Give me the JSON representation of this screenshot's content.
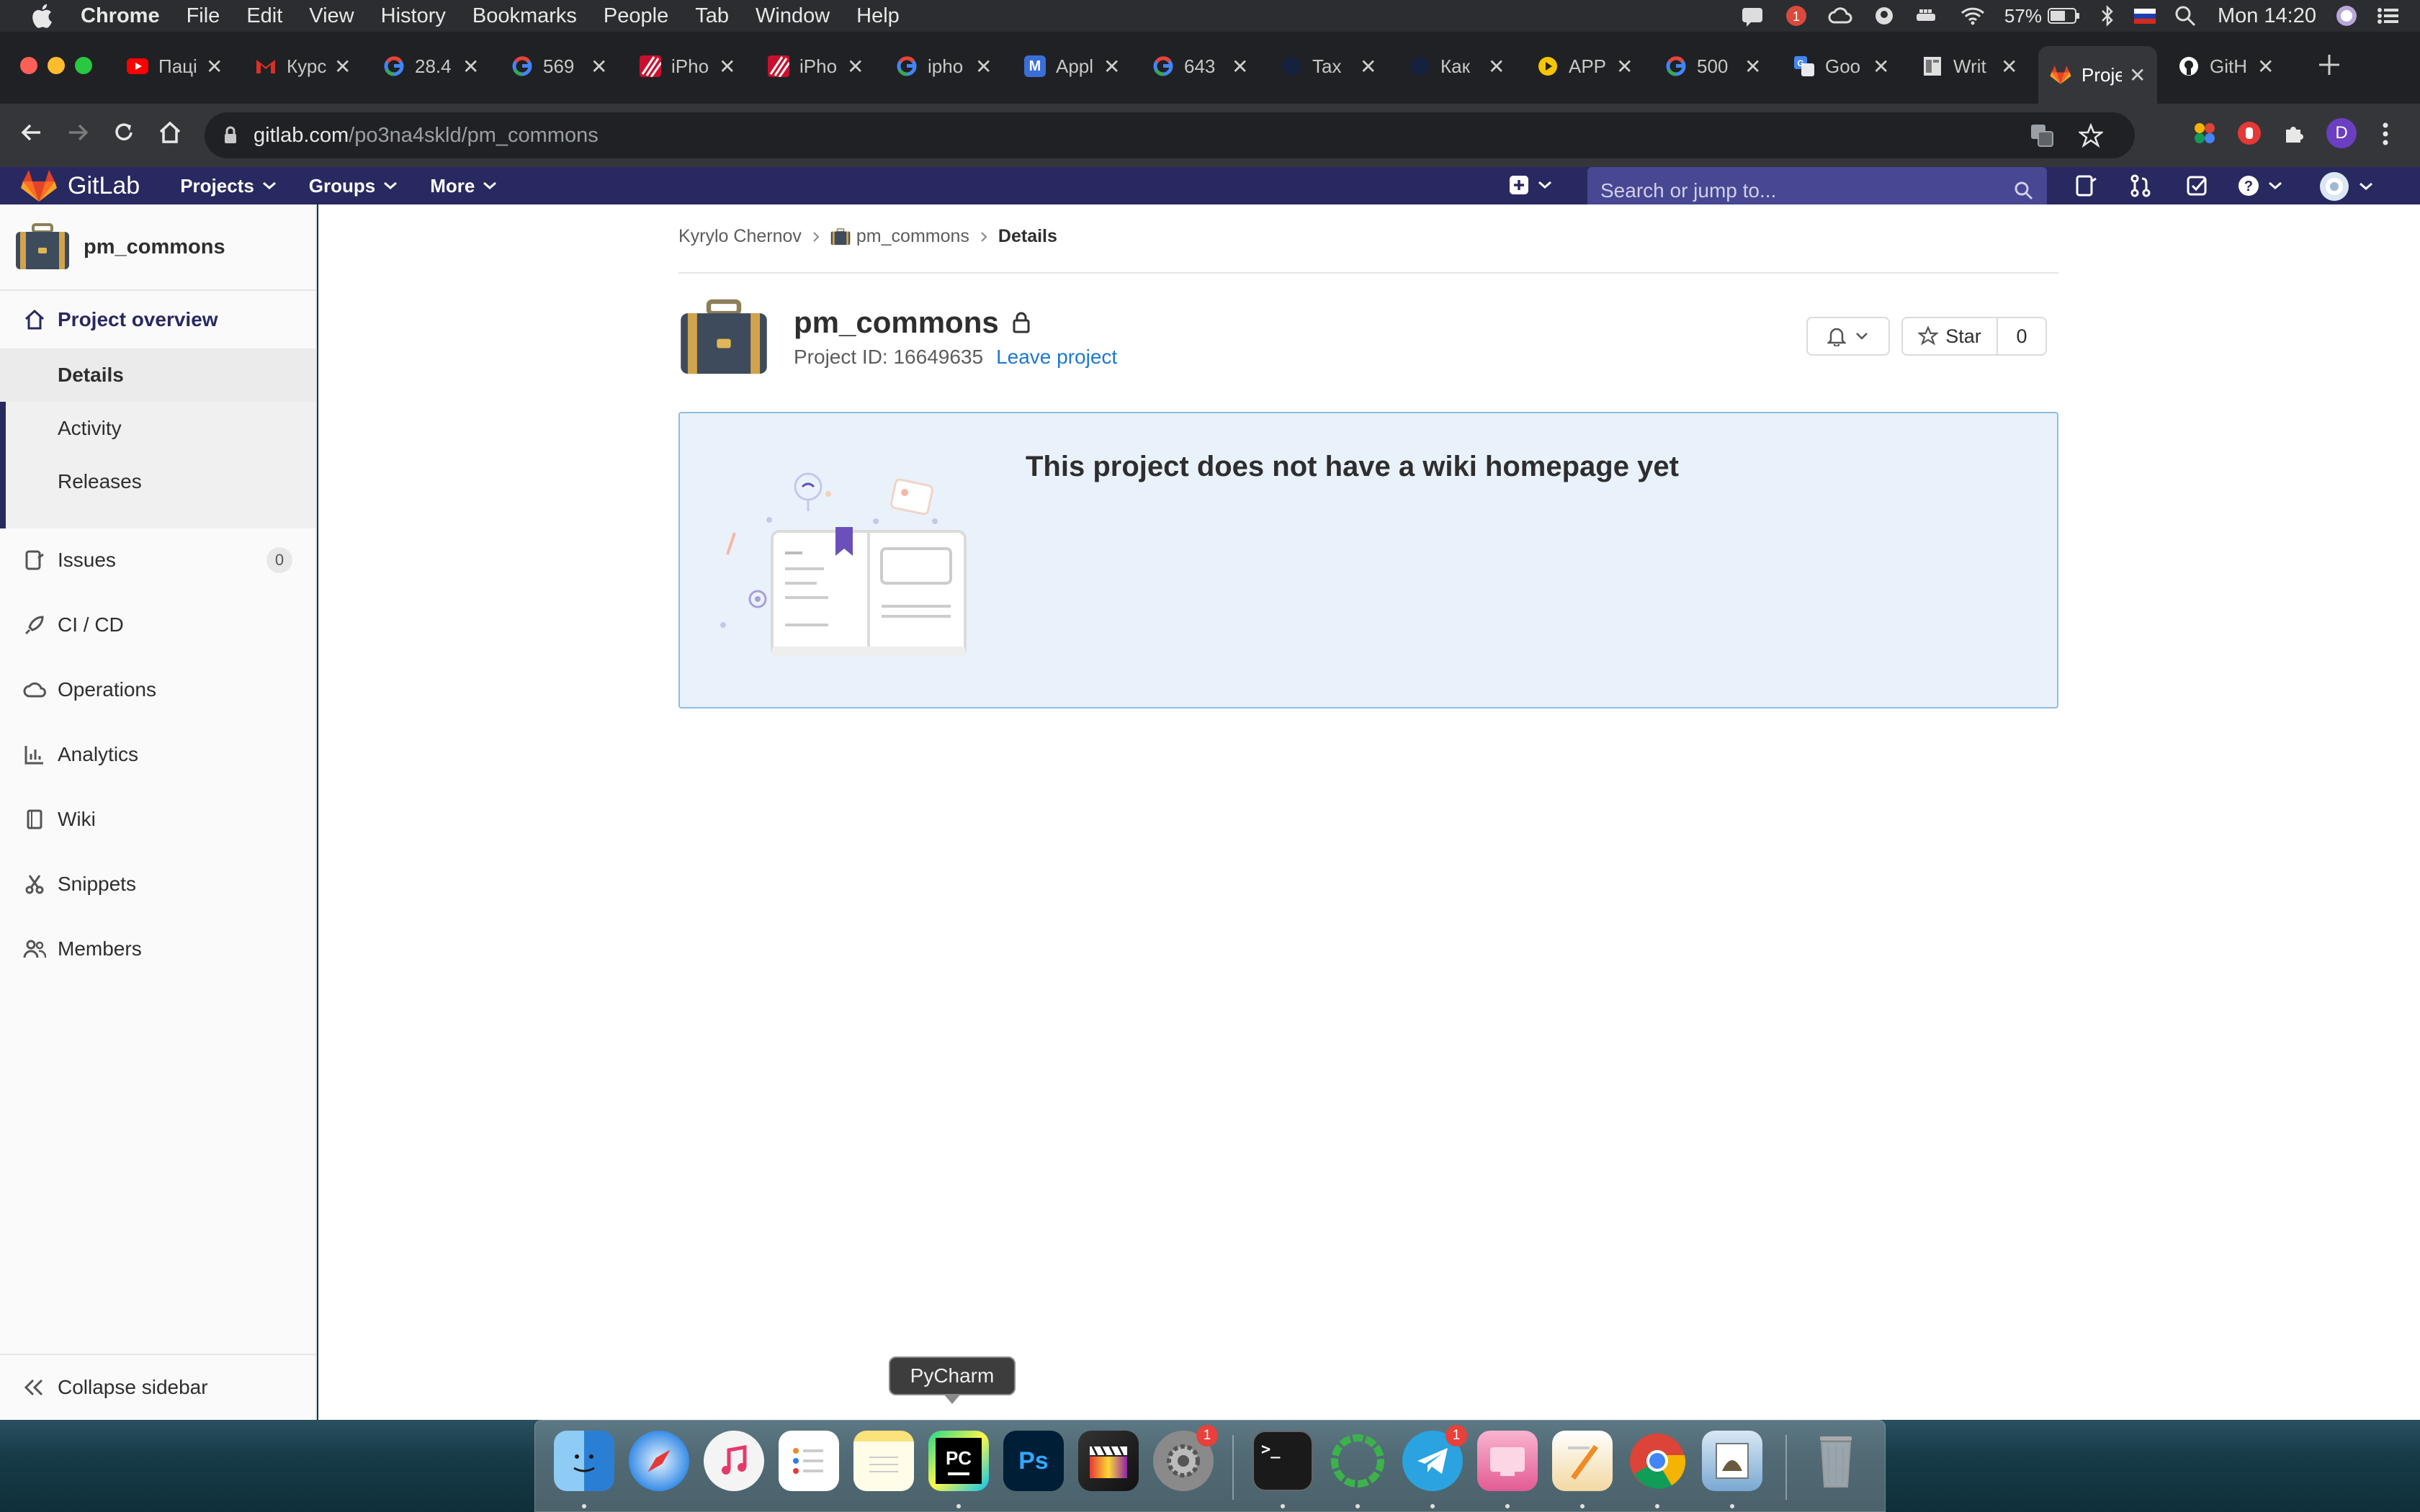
{
  "menubar": {
    "app": "Chrome",
    "items": [
      "File",
      "Edit",
      "View",
      "History",
      "Bookmarks",
      "People",
      "Tab",
      "Window",
      "Help"
    ],
    "battery": "57%",
    "clock": "Mon 14:20"
  },
  "tabs": [
    {
      "title": "Пацi",
      "icon": "youtube-icon",
      "color": "#ff0000"
    },
    {
      "title": "Курс",
      "icon": "gmail-icon",
      "color": "#d93025"
    },
    {
      "title": "28.4",
      "icon": "google-icon",
      "color": "#4285f4"
    },
    {
      "title": "569",
      "icon": "google-icon",
      "color": "#4285f4"
    },
    {
      "title": "iPho",
      "icon": "stripes-icon",
      "color": "#c8102e"
    },
    {
      "title": "iPho",
      "icon": "stripes-icon",
      "color": "#c8102e"
    },
    {
      "title": "ipho",
      "icon": "google-icon",
      "color": "#4285f4"
    },
    {
      "title": "Appl",
      "icon": "m-icon",
      "color": "#3b6fd8"
    },
    {
      "title": "643",
      "icon": "google-icon",
      "color": "#4285f4"
    },
    {
      "title": "Tax",
      "icon": "dark-circle-icon",
      "color": "#16213e"
    },
    {
      "title": "Как",
      "icon": "dark-circle-icon",
      "color": "#16213e"
    },
    {
      "title": "APP",
      "icon": "play-icon",
      "color": "#f6c500"
    },
    {
      "title": "500",
      "icon": "google-icon",
      "color": "#4285f4"
    },
    {
      "title": "Goo",
      "icon": "translate-icon",
      "color": "#4285f4"
    },
    {
      "title": "Writ",
      "icon": "doc-icon",
      "color": "#8f8f8f"
    },
    {
      "title": "Proje",
      "icon": "gitlab-icon",
      "color": "#e24329",
      "active": true
    },
    {
      "title": "GitH",
      "icon": "github-icon",
      "color": "#ffffff"
    }
  ],
  "address": {
    "host": "gitlab.com",
    "path": "/po3na4skld/pm_commons"
  },
  "profile_initial": "D",
  "gitlab": {
    "brand": "GitLab",
    "nav": [
      "Projects",
      "Groups",
      "More"
    ],
    "search_placeholder": "Search or jump to..."
  },
  "sidebar": {
    "project_name": "pm_commons",
    "overview": "Project overview",
    "overview_sub": [
      "Details",
      "Activity",
      "Releases"
    ],
    "items": [
      {
        "label": "Issues",
        "icon": "issues-icon",
        "count": "0"
      },
      {
        "label": "CI / CD",
        "icon": "rocket-icon"
      },
      {
        "label": "Operations",
        "icon": "cloud-icon"
      },
      {
        "label": "Analytics",
        "icon": "chart-icon"
      },
      {
        "label": "Wiki",
        "icon": "book-icon"
      },
      {
        "label": "Snippets",
        "icon": "scissors-icon"
      },
      {
        "label": "Members",
        "icon": "users-icon"
      }
    ],
    "collapse": "Collapse sidebar"
  },
  "breadcrumb": {
    "owner": "Kyrylo Chernov",
    "project": "pm_commons",
    "current": "Details"
  },
  "project": {
    "name": "pm_commons",
    "id_text": "Project ID: 16649635",
    "leave": "Leave project",
    "star_label": "Star",
    "star_count": "0"
  },
  "wiki_empty": {
    "message": "This project does not have a wiki homepage yet"
  },
  "dock": {
    "tooltip": "PyCharm",
    "apps": [
      "Finder",
      "Safari",
      "iTunes",
      "Reminders",
      "Notes",
      "PyCharm",
      "Photoshop",
      "Final Cut Pro",
      "System Preferences",
      "Terminal",
      "Cinema",
      "Telegram",
      "CleanMyMac",
      "Pages",
      "Chrome",
      "Preview",
      "Trash"
    ],
    "sys_prefs_badge": "1",
    "telegram_badge": "1"
  },
  "colors": {
    "gitlab_header": "#292961",
    "accent": "#1f78d1",
    "sidebar_active": "#292961",
    "wiki_box": "#e9f2fb"
  }
}
